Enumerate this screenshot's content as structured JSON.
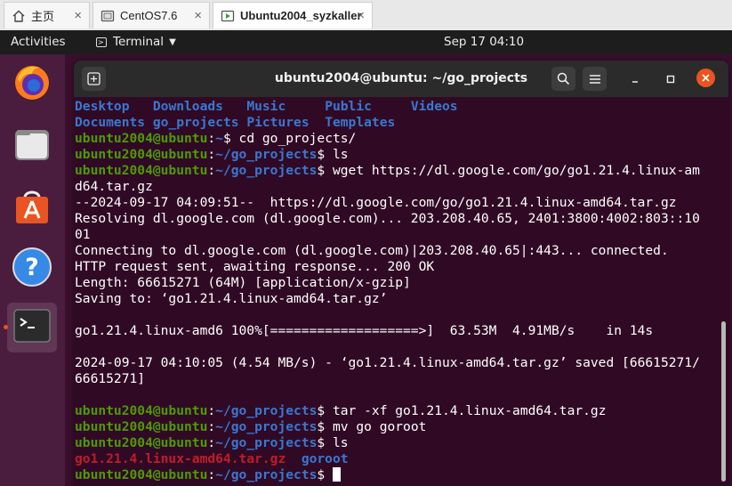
{
  "vm_tabs": [
    {
      "label": "主页",
      "icon": "home-icon"
    },
    {
      "label": "CentOS7.6",
      "icon": "vm-screen-icon"
    },
    {
      "label": "Ubuntu2004_syzkaller",
      "icon": "vm-running-icon"
    }
  ],
  "tab_close_glyph": "×",
  "topbar": {
    "activities": "Activities",
    "app_name": "Terminal",
    "clock": "Sep 17  04:10"
  },
  "dock_icons": [
    "firefox-icon",
    "files-icon",
    "software-center-icon",
    "help-icon",
    "terminal-icon"
  ],
  "terminal": {
    "title": "ubuntu2004@ubuntu: ~/go_projects",
    "user_host": "ubuntu2004@ubuntu",
    "prompt_sep": ":",
    "prompt_end": "$",
    "lines": [
      {
        "segments": [
          {
            "t": "Desktop   ",
            "c": "blue"
          },
          {
            "t": "Downloads   ",
            "c": "blue"
          },
          {
            "t": "Music     ",
            "c": "blue"
          },
          {
            "t": "Public     ",
            "c": "blue"
          },
          {
            "t": "Videos",
            "c": "blue"
          }
        ]
      },
      {
        "segments": [
          {
            "t": "Documents ",
            "c": "blue"
          },
          {
            "t": "go_projects ",
            "c": "blue"
          },
          {
            "t": "Pictures  ",
            "c": "blue"
          },
          {
            "t": "Templates",
            "c": "blue"
          }
        ]
      },
      {
        "segments": [
          {
            "t": "ubuntu2004@ubuntu",
            "c": "green"
          },
          {
            "t": ":",
            "c": "white"
          },
          {
            "t": "~",
            "c": "blue"
          },
          {
            "t": "$ cd go_projects/",
            "c": "white"
          }
        ]
      },
      {
        "segments": [
          {
            "t": "ubuntu2004@ubuntu",
            "c": "green"
          },
          {
            "t": ":",
            "c": "white"
          },
          {
            "t": "~/go_projects",
            "c": "blue"
          },
          {
            "t": "$ ls",
            "c": "white"
          }
        ]
      },
      {
        "segments": [
          {
            "t": "ubuntu2004@ubuntu",
            "c": "green"
          },
          {
            "t": ":",
            "c": "white"
          },
          {
            "t": "~/go_projects",
            "c": "blue"
          },
          {
            "t": "$ wget https://dl.google.com/go/go1.21.4.linux-am",
            "c": "white"
          }
        ]
      },
      {
        "segments": [
          {
            "t": "d64.tar.gz",
            "c": "white"
          }
        ]
      },
      {
        "segments": [
          {
            "t": "--2024-09-17 04:09:51--  https://dl.google.com/go/go1.21.4.linux-amd64.tar.gz",
            "c": "white"
          }
        ]
      },
      {
        "segments": [
          {
            "t": "Resolving dl.google.com (dl.google.com)... 203.208.40.65, 2401:3800:4002:803::10",
            "c": "white"
          }
        ]
      },
      {
        "segments": [
          {
            "t": "01",
            "c": "white"
          }
        ]
      },
      {
        "segments": [
          {
            "t": "Connecting to dl.google.com (dl.google.com)|203.208.40.65|:443... connected.",
            "c": "white"
          }
        ]
      },
      {
        "segments": [
          {
            "t": "HTTP request sent, awaiting response... 200 OK",
            "c": "white"
          }
        ]
      },
      {
        "segments": [
          {
            "t": "Length: 66615271 (64M) [application/x-gzip]",
            "c": "white"
          }
        ]
      },
      {
        "segments": [
          {
            "t": "Saving to: ‘go1.21.4.linux-amd64.tar.gz’",
            "c": "white"
          }
        ]
      },
      {
        "segments": []
      },
      {
        "segments": [
          {
            "t": "go1.21.4.linux-amd6 100%[===================>]  63.53M  4.91MB/s    in 14s",
            "c": "white"
          }
        ]
      },
      {
        "segments": []
      },
      {
        "segments": [
          {
            "t": "2024-09-17 04:10:05 (4.54 MB/s) - ‘go1.21.4.linux-amd64.tar.gz’ saved [66615271/",
            "c": "white"
          }
        ]
      },
      {
        "segments": [
          {
            "t": "66615271]",
            "c": "white"
          }
        ]
      },
      {
        "segments": []
      },
      {
        "segments": [
          {
            "t": "ubuntu2004@ubuntu",
            "c": "green"
          },
          {
            "t": ":",
            "c": "white"
          },
          {
            "t": "~/go_projects",
            "c": "blue"
          },
          {
            "t": "$ tar -xf go1.21.4.linux-amd64.tar.gz",
            "c": "white"
          }
        ]
      },
      {
        "segments": [
          {
            "t": "ubuntu2004@ubuntu",
            "c": "green"
          },
          {
            "t": ":",
            "c": "white"
          },
          {
            "t": "~/go_projects",
            "c": "blue"
          },
          {
            "t": "$ mv go goroot",
            "c": "white"
          }
        ]
      },
      {
        "segments": [
          {
            "t": "ubuntu2004@ubuntu",
            "c": "green"
          },
          {
            "t": ":",
            "c": "white"
          },
          {
            "t": "~/go_projects",
            "c": "blue"
          },
          {
            "t": "$ ls",
            "c": "white"
          }
        ]
      },
      {
        "segments": [
          {
            "t": "go1.21.4.linux-amd64.tar.gz",
            "c": "red"
          },
          {
            "t": "  ",
            "c": "white"
          },
          {
            "t": "goroot",
            "c": "blue"
          }
        ]
      },
      {
        "segments": [
          {
            "t": "ubuntu2004@ubuntu",
            "c": "green"
          },
          {
            "t": ":",
            "c": "white"
          },
          {
            "t": "~/go_projects",
            "c": "blue"
          },
          {
            "t": "$ ",
            "c": "white"
          }
        ],
        "cursor": true
      }
    ]
  },
  "colors": {
    "terminal_bg": "#300a24",
    "prompt_green": "#4e9a06",
    "directory_blue": "#3b77d0",
    "archive_red": "#c01c28",
    "close_orange": "#e95420"
  }
}
